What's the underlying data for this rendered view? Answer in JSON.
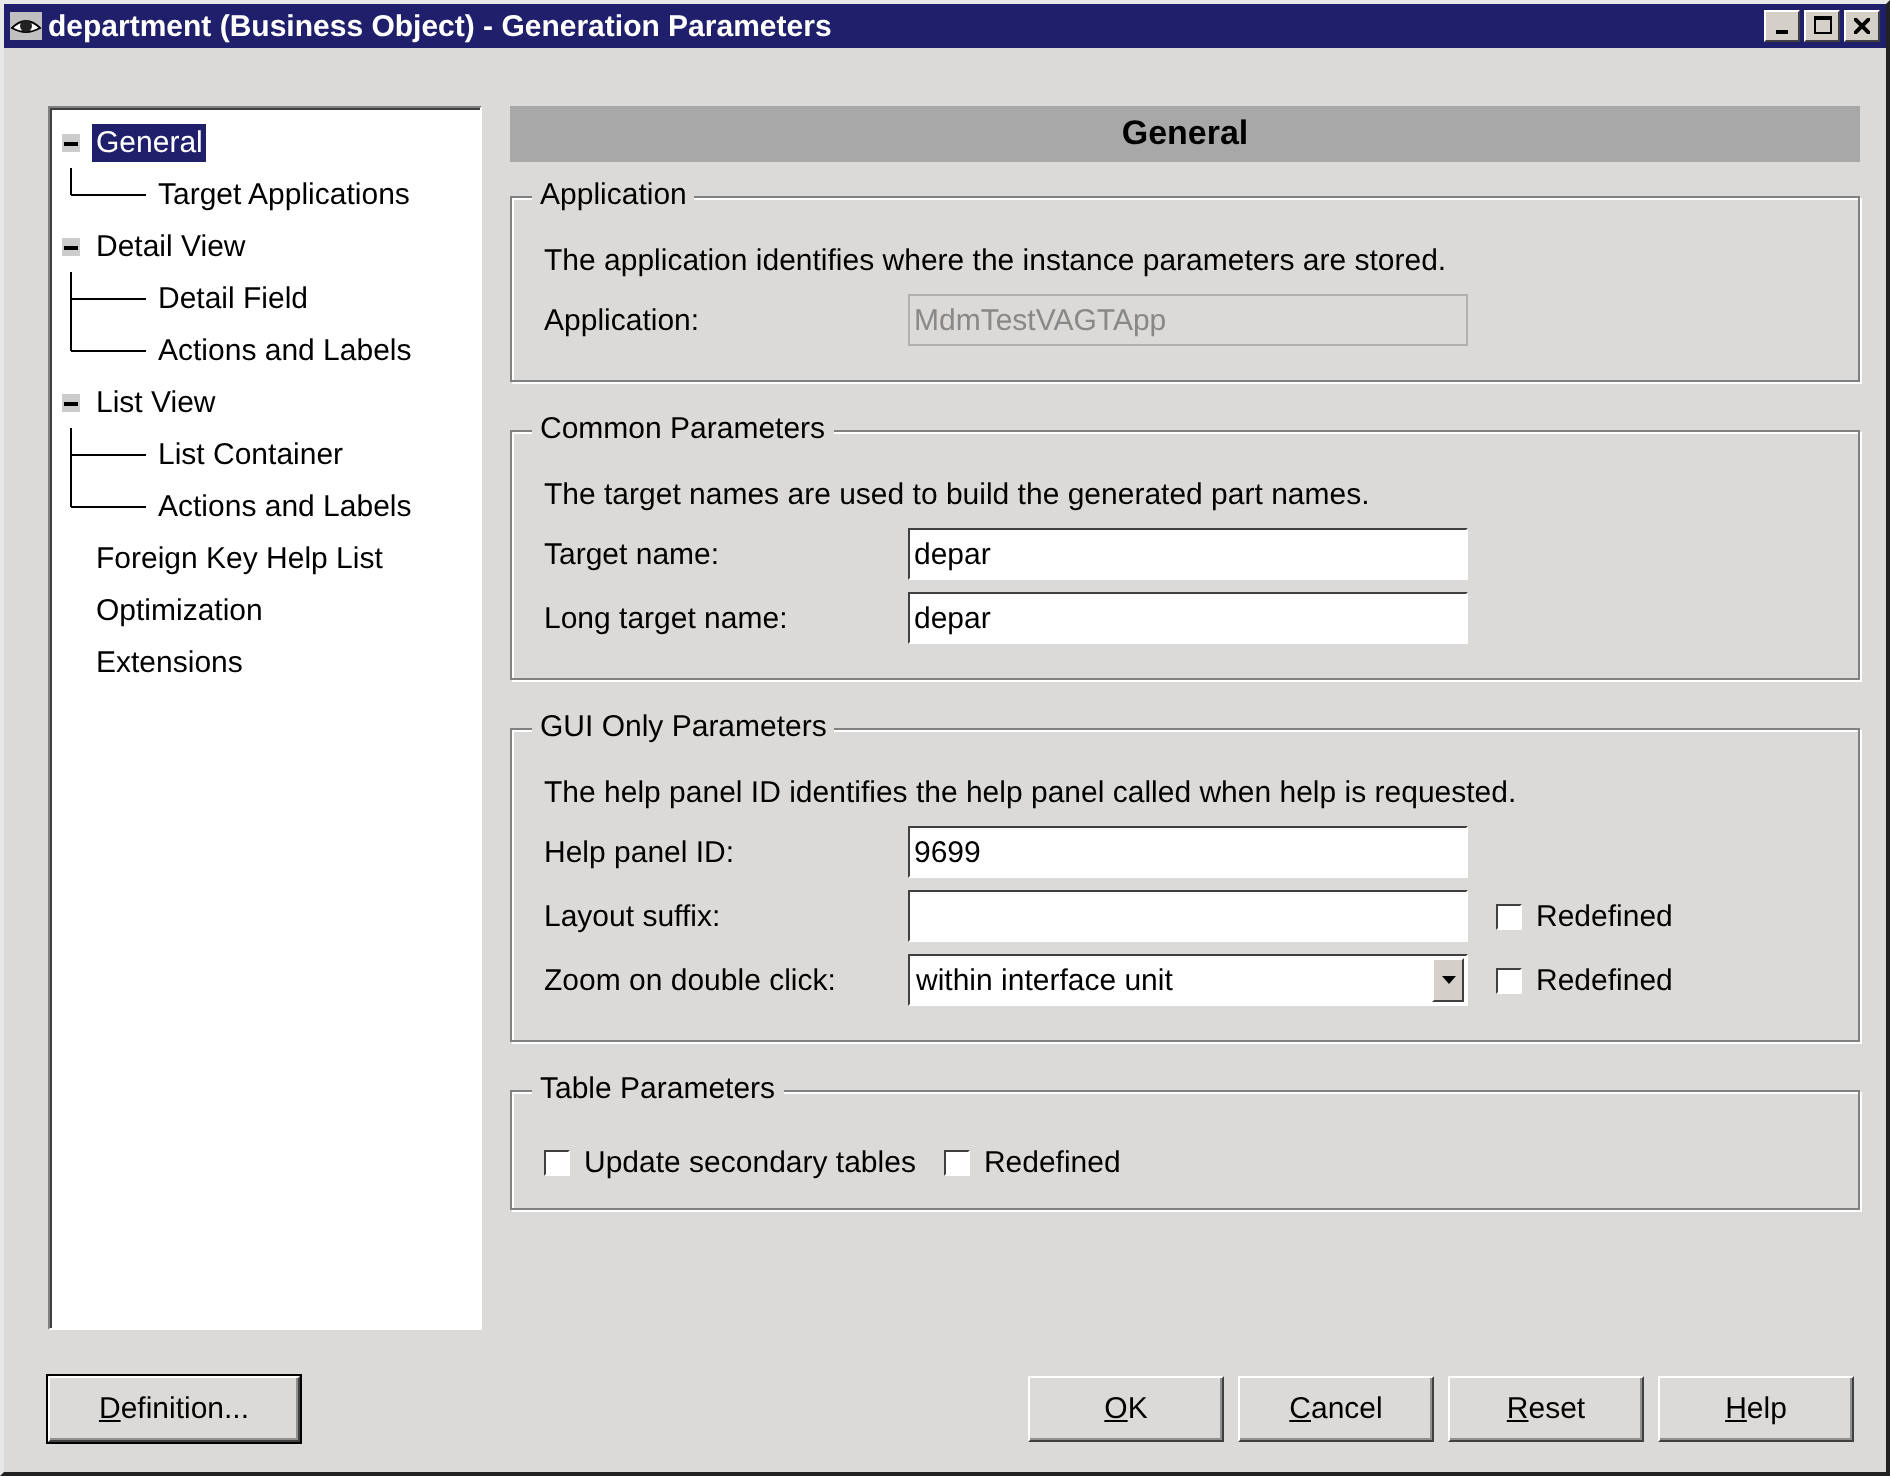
{
  "window": {
    "title": "department (Business Object) - Generation Parameters"
  },
  "tree": [
    {
      "label": "General",
      "selected": true,
      "expanded": true,
      "children": [
        {
          "label": "Target Applications",
          "selected": false
        }
      ]
    },
    {
      "label": "Detail View",
      "selected": false,
      "expanded": true,
      "children": [
        {
          "label": "Detail Field",
          "selected": false
        },
        {
          "label": "Actions and Labels",
          "selected": false
        }
      ]
    },
    {
      "label": "List View",
      "selected": false,
      "expanded": true,
      "children": [
        {
          "label": "List Container",
          "selected": false
        },
        {
          "label": "Actions and Labels",
          "selected": false
        }
      ]
    },
    {
      "label": "Foreign Key Help List",
      "selected": false
    },
    {
      "label": "Optimization",
      "selected": false
    },
    {
      "label": "Extensions",
      "selected": false
    }
  ],
  "panel": {
    "header": "General",
    "groups": [
      {
        "title": "Application",
        "description": "The application identifies where the instance parameters are stored.",
        "rows": [
          {
            "kind": "text",
            "label": "Application:",
            "value": "MdmTestVAGTApp",
            "disabled": true
          }
        ]
      },
      {
        "title": "Common Parameters",
        "description": "The target names are used to build the generated part names.",
        "rows": [
          {
            "kind": "text",
            "label": "Target name:",
            "value": "depar",
            "disabled": false
          },
          {
            "kind": "text",
            "label": "Long target name:",
            "value": "depar",
            "disabled": false
          }
        ]
      },
      {
        "title": "GUI Only Parameters",
        "description": "The help panel ID identifies the help panel called when help is requested.",
        "rows": [
          {
            "kind": "text",
            "label": "Help panel ID:",
            "value": "9699",
            "disabled": false
          },
          {
            "kind": "text",
            "label": "Layout suffix:",
            "disabled": false,
            "redefined": {
              "label": "Redefined",
              "checked": false
            }
          },
          {
            "kind": "combo",
            "label": "Zoom on double click:",
            "value": "within interface unit",
            "disabled": false,
            "redefined": {
              "label": "Redefined",
              "checked": false
            }
          }
        ]
      },
      {
        "title": "Table Parameters",
        "checks": [
          {
            "label": "Update secondary tables",
            "checked": false
          },
          {
            "label": "Redefined",
            "checked": false
          }
        ]
      }
    ]
  },
  "buttons": [
    {
      "label": "Definition...",
      "mnemonic": true,
      "default": true
    },
    {
      "label": "OK",
      "mnemonic": true,
      "default": false
    },
    {
      "label": "Cancel",
      "mnemonic": true,
      "default": false
    },
    {
      "label": "Reset",
      "mnemonic": true,
      "default": false
    },
    {
      "label": "Help",
      "mnemonic": true,
      "default": false
    }
  ]
}
